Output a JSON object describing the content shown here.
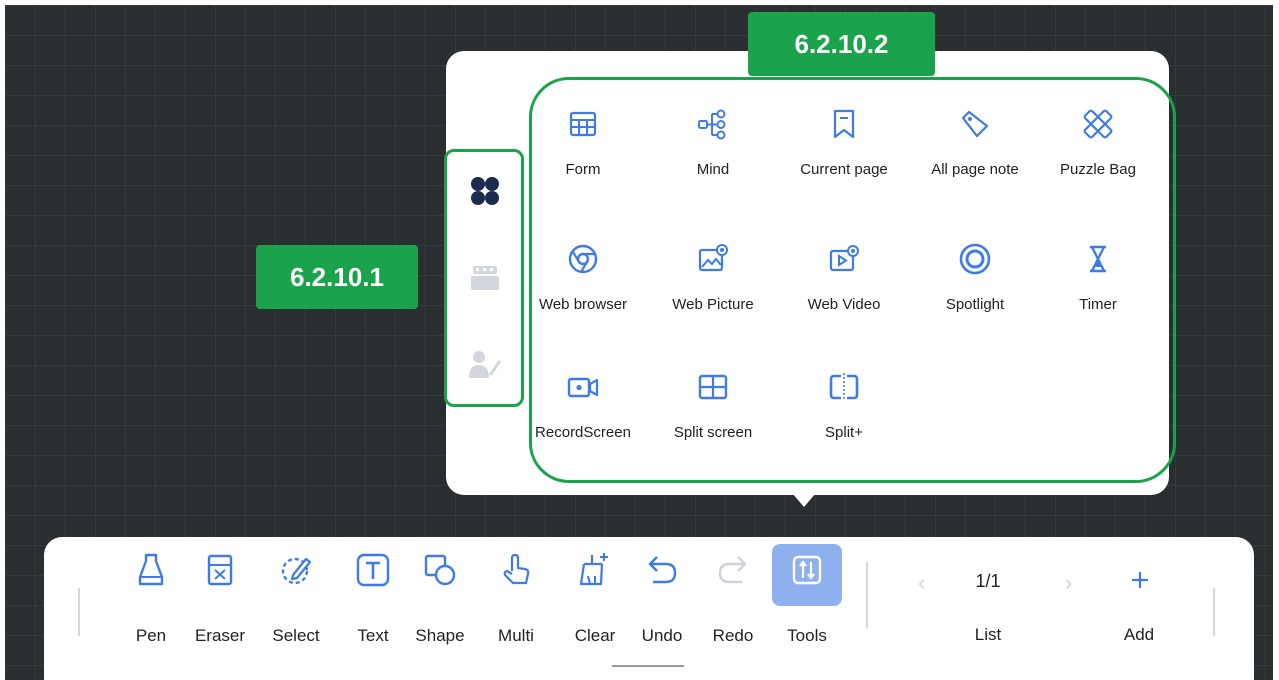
{
  "annotations": {
    "left_label": "6.2.10.1",
    "top_label": "6.2.10.2"
  },
  "colors": {
    "accent": "#3f7be8",
    "highlight": "#1aa34a",
    "active_tool_bg": "#8fb0ef"
  },
  "side_tabs": [
    {
      "icon": "apps-grid-icon",
      "selected": true
    },
    {
      "icon": "keyboard-tray-icon",
      "selected": false
    },
    {
      "icon": "teacher-icon",
      "selected": false
    }
  ],
  "tools_panel": {
    "items": [
      {
        "label": "Form",
        "icon": "table-icon"
      },
      {
        "label": "Mind",
        "icon": "mind-map-icon"
      },
      {
        "label": "Current page",
        "icon": "bookmark-icon"
      },
      {
        "label": "All page note",
        "icon": "tag-icon"
      },
      {
        "label": "Puzzle Bag",
        "icon": "puzzle-icon"
      },
      {
        "label": "Web browser",
        "icon": "browser-icon"
      },
      {
        "label": "Web Picture",
        "icon": "web-picture-icon"
      },
      {
        "label": "Web Video",
        "icon": "web-video-icon"
      },
      {
        "label": "Spotlight",
        "icon": "spotlight-icon"
      },
      {
        "label": "Timer",
        "icon": "hourglass-icon"
      },
      {
        "label": "RecordScreen",
        "icon": "record-screen-icon"
      },
      {
        "label": "Split screen",
        "icon": "split-screen-icon"
      },
      {
        "label": "Split+",
        "icon": "split-plus-icon"
      }
    ]
  },
  "toolbar": {
    "items": [
      {
        "label": "Pen",
        "icon": "pen-icon"
      },
      {
        "label": "Eraser",
        "icon": "eraser-icon"
      },
      {
        "label": "Select",
        "icon": "lasso-icon"
      },
      {
        "label": "Text",
        "icon": "text-icon"
      },
      {
        "label": "Shape",
        "icon": "shape-icon"
      },
      {
        "label": "Multi",
        "icon": "multi-touch-icon"
      },
      {
        "label": "Clear",
        "icon": "broom-icon"
      },
      {
        "label": "Undo",
        "icon": "undo-icon"
      },
      {
        "label": "Redo",
        "icon": "redo-icon"
      },
      {
        "label": "Tools",
        "icon": "tools-icon",
        "active": true
      }
    ],
    "page_indicator": "1/1",
    "list_label": "List",
    "add_label": "Add"
  }
}
